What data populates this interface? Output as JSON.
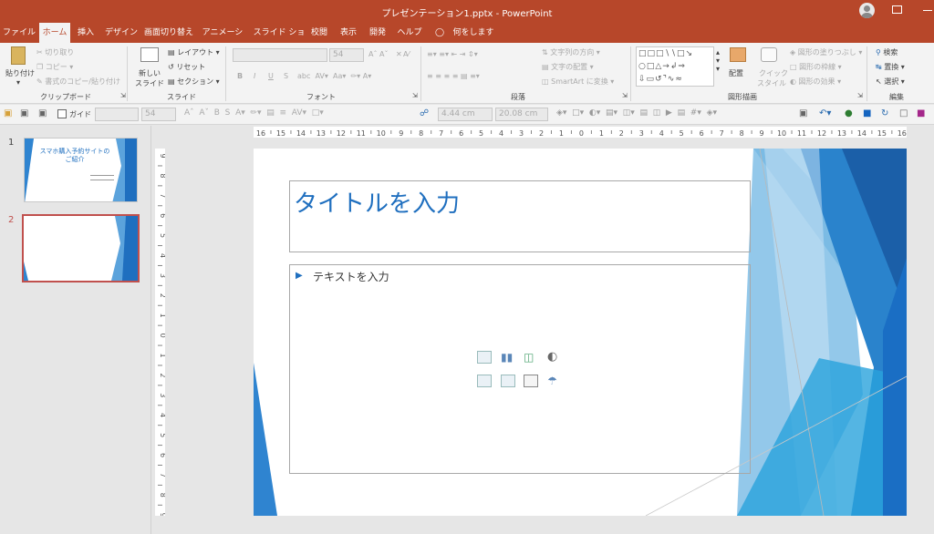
{
  "window": {
    "title": "プレゼンテーション1.pptx  -  PowerPoint"
  },
  "tabs": [
    "ファイル",
    "ホーム",
    "挿入",
    "デザイン",
    "画面切り替え",
    "アニメーション",
    "スライド ショー",
    "校閲",
    "表示",
    "開発",
    "ヘルプ"
  ],
  "tell_me": "何をしますか",
  "clipboard": {
    "paste": "貼り付け",
    "cut": "切り取り",
    "copy": "コピー",
    "format_painter": "書式のコピー/貼り付け",
    "label": "クリップボード"
  },
  "slides_group": {
    "new_slide": "新しい",
    "new_slide2": "スライド",
    "layout": "レイアウト",
    "reset": "リセット",
    "section": "セクション",
    "label": "スライド"
  },
  "font_group": {
    "size": "54",
    "label": "フォント",
    "bold": "B",
    "italic": "I",
    "underline": "U",
    "shadow": "S"
  },
  "paragraph_group": {
    "text_direction": "文字列の方向",
    "align_text": "文字の配置",
    "smartart": "SmartArt に変換",
    "label": "段落"
  },
  "drawing_group": {
    "arrange": "配置",
    "quick_styles1": "クイック",
    "quick_styles2": "スタイル",
    "fill": "図形の塗りつぶし",
    "outline": "図形の枠線",
    "effects": "図形の効果",
    "label": "図形描画"
  },
  "editing_group": {
    "find": "検索",
    "replace": "置換",
    "select": "選択",
    "label": "編集"
  },
  "qat": {
    "guides": "ガイド",
    "font_size": "54",
    "height": "4.44 cm",
    "width": "20.08 cm"
  },
  "thumbnails": [
    {
      "num": "1",
      "title1": "スマホ購入予約サイトの",
      "title2": "ご紹介"
    },
    {
      "num": "2"
    }
  ],
  "ruler": {
    "h_ticks": [
      "16",
      "15",
      "14",
      "13",
      "12",
      "11",
      "10",
      "9",
      "8",
      "7",
      "6",
      "5",
      "4",
      "3",
      "2",
      "1",
      "0",
      "1",
      "2",
      "3",
      "4",
      "5",
      "6",
      "7",
      "8",
      "9",
      "10",
      "11",
      "12",
      "13",
      "14",
      "15",
      "16"
    ],
    "v_ticks": [
      "9",
      "8",
      "7",
      "6",
      "5",
      "4",
      "3",
      "2",
      "1",
      "0",
      "1",
      "2",
      "3",
      "4",
      "5",
      "6",
      "7",
      "8",
      "9"
    ]
  },
  "slide": {
    "title": "タイトルを入力",
    "body": "テキストを入力"
  },
  "colors": {
    "accent": "#b7472a",
    "slide_blue": "#1f6fbf"
  }
}
